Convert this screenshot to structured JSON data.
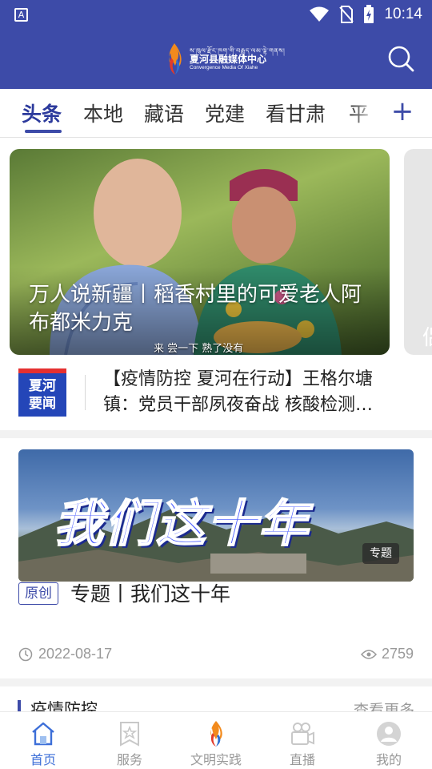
{
  "status_bar": {
    "time": "10:14",
    "notif_letter": "A"
  },
  "header": {
    "logo_tibetan": "ས་ཁུལ་རྫོང་ཁག་གི་བརྒྱུད་ལམ་ལྟེ་གནས།",
    "logo_cn": "夏河县融媒体中心",
    "logo_en": "Convergence Media Of Xiahe",
    "accent_color": "#3d4ba8"
  },
  "tabs": {
    "items": [
      "头条",
      "本地",
      "藏语",
      "党建",
      "看甘肃",
      "平"
    ],
    "active_index": 0,
    "add_label": "+"
  },
  "carousel": {
    "title": "万人说新疆丨稻香村里的可爱老人阿布都米力克",
    "subtitle": "来 尝一下 熟了没有",
    "next_peek_text": "侣"
  },
  "ticker": {
    "badge_line1": "夏河",
    "badge_line2": "要闻",
    "text": "【疫情防控 夏河在行动】王格尔塘镇：党员干部夙夜奋战 核酸检测…"
  },
  "article": {
    "banner_text": "我们这十年",
    "banner_tag": "专题",
    "original_tag": "原创",
    "title": "专题丨我们这十年",
    "date": "2022-08-17",
    "views": "2759"
  },
  "section": {
    "title": "疫情防控",
    "more_label": "查看更多"
  },
  "bottom_nav": {
    "items": [
      {
        "label": "首页",
        "icon": "home-icon"
      },
      {
        "label": "服务",
        "icon": "service-icon"
      },
      {
        "label": "文明实践",
        "icon": "flame-logo-icon"
      },
      {
        "label": "直播",
        "icon": "live-camera-icon"
      },
      {
        "label": "我的",
        "icon": "profile-icon"
      }
    ],
    "active_index": 0,
    "active_color": "#3d6fd8"
  }
}
